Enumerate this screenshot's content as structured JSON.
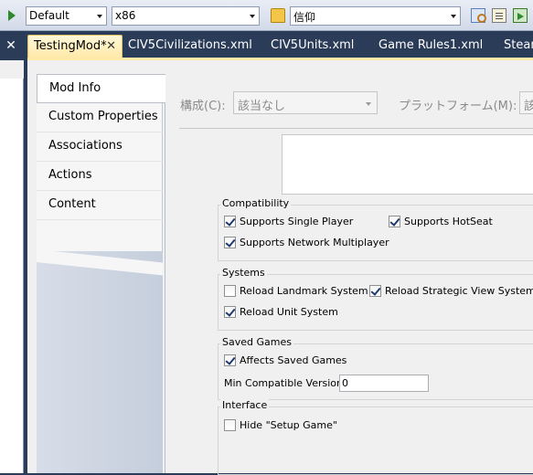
{
  "toolbar": {
    "configuration_value": "Default",
    "platform_value": "x86",
    "find_value": "信仰",
    "icons": [
      "start-debug-icon",
      "open-file-icon",
      "find-in-files-icon",
      "properties-icon",
      "export-icon"
    ]
  },
  "tabs": [
    {
      "label": "TestingMod*",
      "active": true,
      "closable": true
    },
    {
      "label": "CIV5Civilizations.xml",
      "active": false
    },
    {
      "label": "CIV5Units.xml",
      "active": false
    },
    {
      "label": "Game Rules1.xml",
      "active": false
    },
    {
      "label": "Stear",
      "active": false
    }
  ],
  "side_nav": {
    "items": [
      {
        "label": "Mod Info",
        "selected": true
      },
      {
        "label": "Custom Properties"
      },
      {
        "label": "Associations"
      },
      {
        "label": "Actions"
      },
      {
        "label": "Content"
      }
    ]
  },
  "config_bar": {
    "configuration_label": "構成(C):",
    "configuration_value": "該当なし",
    "platform_label": "プラットフォーム(M):",
    "platform_value": "該"
  },
  "compatibility": {
    "title": "Compatibility",
    "single_player": {
      "label": "Supports Single Player",
      "checked": true
    },
    "hotseat": {
      "label": "Supports HotSeat",
      "checked": true
    },
    "network_multiplayer": {
      "label": "Supports Network Multiplayer",
      "checked": true
    }
  },
  "systems": {
    "title": "Systems",
    "reload_landmark": {
      "label": "Reload Landmark System",
      "checked": false
    },
    "reload_strategic_view": {
      "label": "Reload Strategic View System",
      "checked": true
    },
    "reload_unit": {
      "label": "Reload Unit System",
      "checked": true
    }
  },
  "saved_games": {
    "title": "Saved Games",
    "affects_saved_games": {
      "label": "Affects Saved Games",
      "checked": true
    },
    "min_version_label": "Min Compatible Version:",
    "min_version_value": "0"
  },
  "interface": {
    "title": "Interface",
    "hide_setup_game": {
      "label": "Hide \"Setup Game\"",
      "checked": false
    }
  },
  "colors": {
    "frame_dark": "#2b3c59",
    "active_tab": "#ffe9a8",
    "panel_bg": "#f0f0f0"
  }
}
